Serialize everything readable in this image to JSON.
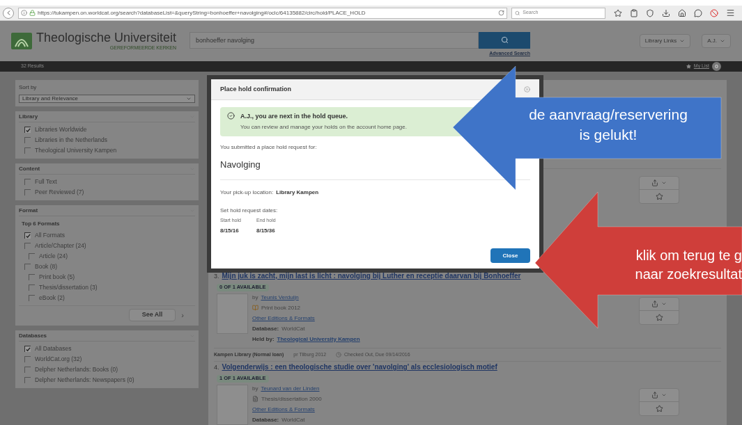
{
  "browser": {
    "url": "https://tukampen.on.worldcat.org/search?databaseList=&queryString=bonhoeffer+navolging#/oclc/64135882/circ/hold/PLACE_HOLD",
    "search_placeholder": "Search"
  },
  "header": {
    "logo_text": "Theologische Universiteit",
    "logo_subtext": "GEREFORMEERDE KERKEN",
    "search_value": "bonhoeffer navolging",
    "advanced_search": "Advanced Search",
    "menus": [
      "Library Links",
      "A.J."
    ]
  },
  "results_bar": {
    "count": "32 Results",
    "my_list": "My List",
    "my_list_count": "0"
  },
  "sidebar": {
    "sort": {
      "label": "Sort by",
      "value": "Library and Relevance"
    },
    "facets": [
      {
        "title": "Library",
        "items": [
          {
            "label": "Libraries Worldwide",
            "checked": true
          },
          {
            "label": "Libraries in the Netherlands",
            "checked": false
          },
          {
            "label": "Theological University Kampen",
            "checked": false
          }
        ]
      },
      {
        "title": "Content",
        "items": [
          {
            "label": "Full Text",
            "checked": false
          },
          {
            "label": "Peer Reviewed (7)",
            "checked": false
          }
        ]
      },
      {
        "title": "Format",
        "subheading": "Top 6 Formats",
        "see_all": "See All",
        "see_all_arrow": "›",
        "items": [
          {
            "label": "All Formats",
            "checked": true
          },
          {
            "label": "Article/Chapter (24)",
            "checked": false,
            "children": [
              {
                "label": "Article (24)",
                "checked": false
              }
            ]
          },
          {
            "label": "Book (8)",
            "checked": false,
            "children": [
              {
                "label": "Print book (5)",
                "checked": false
              },
              {
                "label": "Thesis/dissertation (3)",
                "checked": false
              },
              {
                "label": "eBook (2)",
                "checked": false
              }
            ]
          }
        ]
      },
      {
        "title": "Databases",
        "items": [
          {
            "label": "All Databases",
            "checked": true
          },
          {
            "label": "WorldCat.org (32)",
            "checked": false
          },
          {
            "label": "Delpher Netherlands: Books (0)",
            "checked": false
          },
          {
            "label": "Delpher Netherlands: Newspapers (0)",
            "checked": false
          }
        ]
      }
    ]
  },
  "results": [
    {
      "number": "3.",
      "title": "Mijn juk is zacht, mijn last is licht : navolging bij Luther en receptie daarvan bij Bonhoeffer",
      "availability": "0 OF 1 AVAILABLE",
      "by_label": "by",
      "author": "Teunis Verduijn",
      "kind": "book",
      "format": "Print book 2012",
      "other_editions": "Other Editions & Formats",
      "database_label": "Database:",
      "database": "WorldCat",
      "held_by_label": "Held by:",
      "held_by": "Theological University Kampen",
      "holding": {
        "location": "Kampen Library (Normal loan)",
        "call_number": "pr Tilburg 2012",
        "status": "Checked Out, Due 09/14/2016"
      }
    },
    {
      "number": "4.",
      "title": "Volgenderwijs : een theologische studie over 'navolging' als ecclesiologisch motief",
      "availability": "1 OF 1 AVAILABLE",
      "by_label": "by",
      "author": "Teunard van der Linden",
      "kind": "thesis",
      "format": "Thesis/dissertation 2000",
      "other_editions": "Other Editions & Formats",
      "database_label": "Database:",
      "database": "WorldCat"
    }
  ],
  "modal": {
    "title": "Place hold confirmation",
    "alert_title": "A.J., you are next in the hold queue.",
    "alert_text": "You can review and manage your holds on the account home page.",
    "submitted_label": "You submitted a place hold request for:",
    "item_title": "Navolging",
    "pickup_label": "Your pick-up location:",
    "pickup_value": "Library Kampen",
    "dates_label": "Set hold request dates:",
    "dates": [
      {
        "label": "Start hold",
        "value": "8/15/16"
      },
      {
        "label": "End hold",
        "value": "8/15/36"
      }
    ],
    "close": "Close"
  },
  "callouts": [
    {
      "color": "#3f74c8",
      "lines": [
        "de aanvraag/reservering",
        "is gelukt!"
      ]
    },
    {
      "color": "#cf3e3a",
      "lines": [
        "klik om terug te g",
        "naar zoekresultat"
      ]
    }
  ]
}
